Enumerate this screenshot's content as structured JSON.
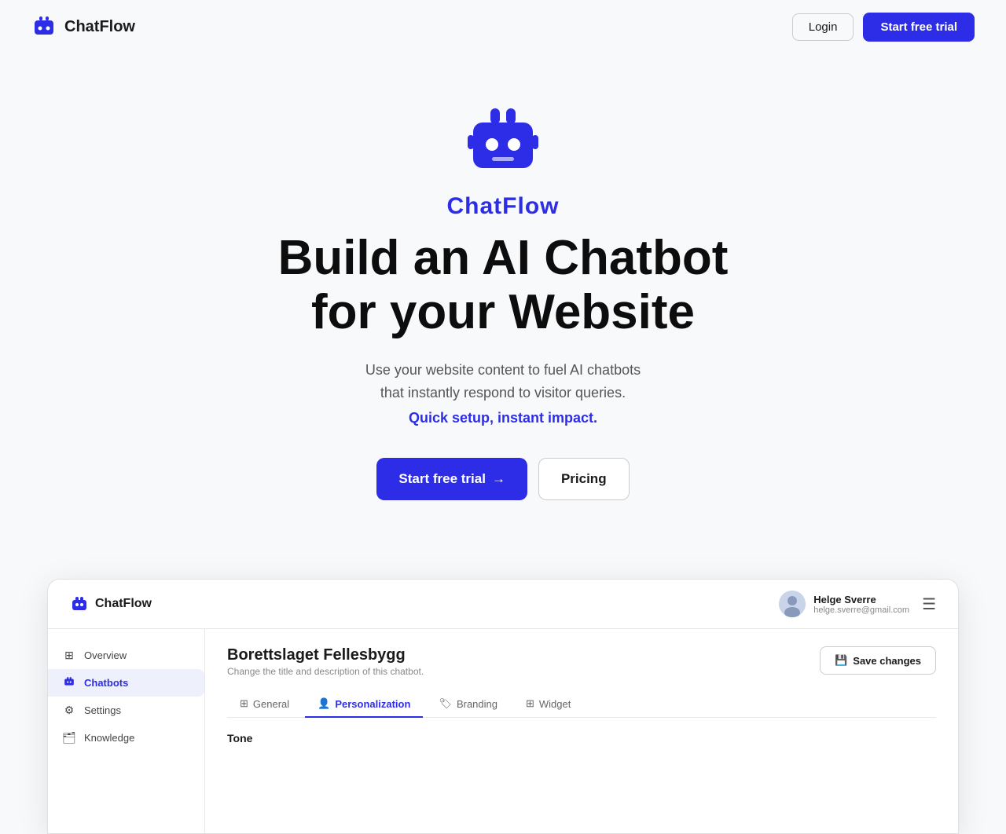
{
  "navbar": {
    "logo_text": "ChatFlow",
    "login_label": "Login",
    "start_trial_label": "Start free trial"
  },
  "hero": {
    "brand_name": "ChatFlow",
    "headline_line1": "Build an AI Chatbot",
    "headline_line2": "for your Website",
    "subtitle_line1": "Use your website content to fuel AI chatbots",
    "subtitle_line2": "that instantly respond to visitor queries.",
    "tagline": "Quick setup, instant impact.",
    "cta_primary": "Start free trial",
    "cta_secondary": "Pricing",
    "arrow": "→"
  },
  "preview": {
    "logo_text": "ChatFlow",
    "user_name": "Helge Sverre",
    "user_email": "helge.sverre@gmail.com",
    "sidebar": {
      "items": [
        {
          "label": "Overview",
          "icon": "⊞",
          "active": false
        },
        {
          "label": "Chatbots",
          "icon": "🤖",
          "active": true
        },
        {
          "label": "Settings",
          "icon": "⚙",
          "active": false
        },
        {
          "label": "Knowledge",
          "icon": "🗂",
          "active": false
        }
      ]
    },
    "main": {
      "title": "Borettslaget Fellesbygg",
      "description": "Change the title and description of this chatbot.",
      "save_label": "Save changes",
      "tabs": [
        {
          "label": "General",
          "icon": "⊞",
          "active": false
        },
        {
          "label": "Personalization",
          "icon": "👤",
          "active": true
        },
        {
          "label": "Branding",
          "icon": "🏷",
          "active": false
        },
        {
          "label": "Widget",
          "icon": "⊞",
          "active": false
        }
      ],
      "section_label": "Tone"
    }
  }
}
